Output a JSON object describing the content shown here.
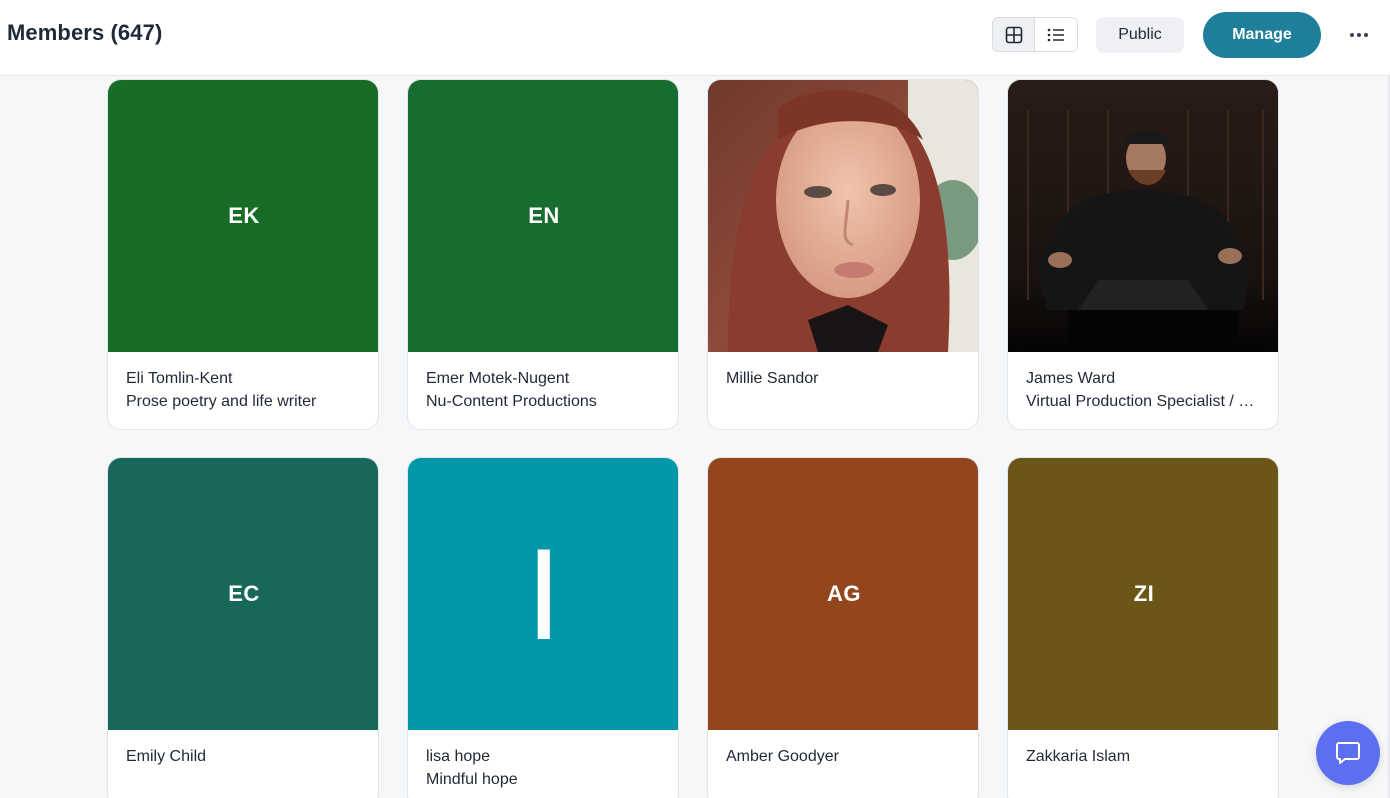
{
  "header": {
    "title": "Members (647)",
    "public_label": "Public",
    "manage_label": "Manage"
  },
  "colors": {
    "accent": "#1f7f9a",
    "chat": "#5b6ff0"
  },
  "icons": {
    "grid_view": "grid-icon",
    "list_view": "list-icon",
    "more": "ellipsis-icon",
    "chat": "chat-bubble-icon"
  },
  "members": [
    {
      "initials": "EK",
      "name": "Eli Tomlin-Kent",
      "subtitle": "Prose poetry and life writer",
      "color": "#176d26",
      "photo": ""
    },
    {
      "initials": "EN",
      "name": "Emer Motek-Nugent",
      "subtitle": "Nu-Content Productions",
      "color": "#176d30",
      "photo": ""
    },
    {
      "initials": "",
      "name": "Millie Sandor",
      "subtitle": "",
      "color": "#b98b70",
      "photo": "portrait-red-hair"
    },
    {
      "initials": "",
      "name": "James Ward",
      "subtitle": "Virtual Production Specialist / Cinematographer",
      "color": "#161616",
      "photo": "portrait-dark-room"
    },
    {
      "initials": "EC",
      "name": "Emily Child",
      "subtitle": "",
      "color": "#17675a",
      "photo": ""
    },
    {
      "initials": "I",
      "name": "lisa hope",
      "subtitle": "Mindful hope",
      "color": "#0098a8",
      "photo": ""
    },
    {
      "initials": "AG",
      "name": "Amber Goodyer",
      "subtitle": "",
      "color": "#93461e",
      "photo": ""
    },
    {
      "initials": "ZI",
      "name": "Zakkaria Islam",
      "subtitle": "",
      "color": "#6b5618",
      "photo": ""
    }
  ]
}
